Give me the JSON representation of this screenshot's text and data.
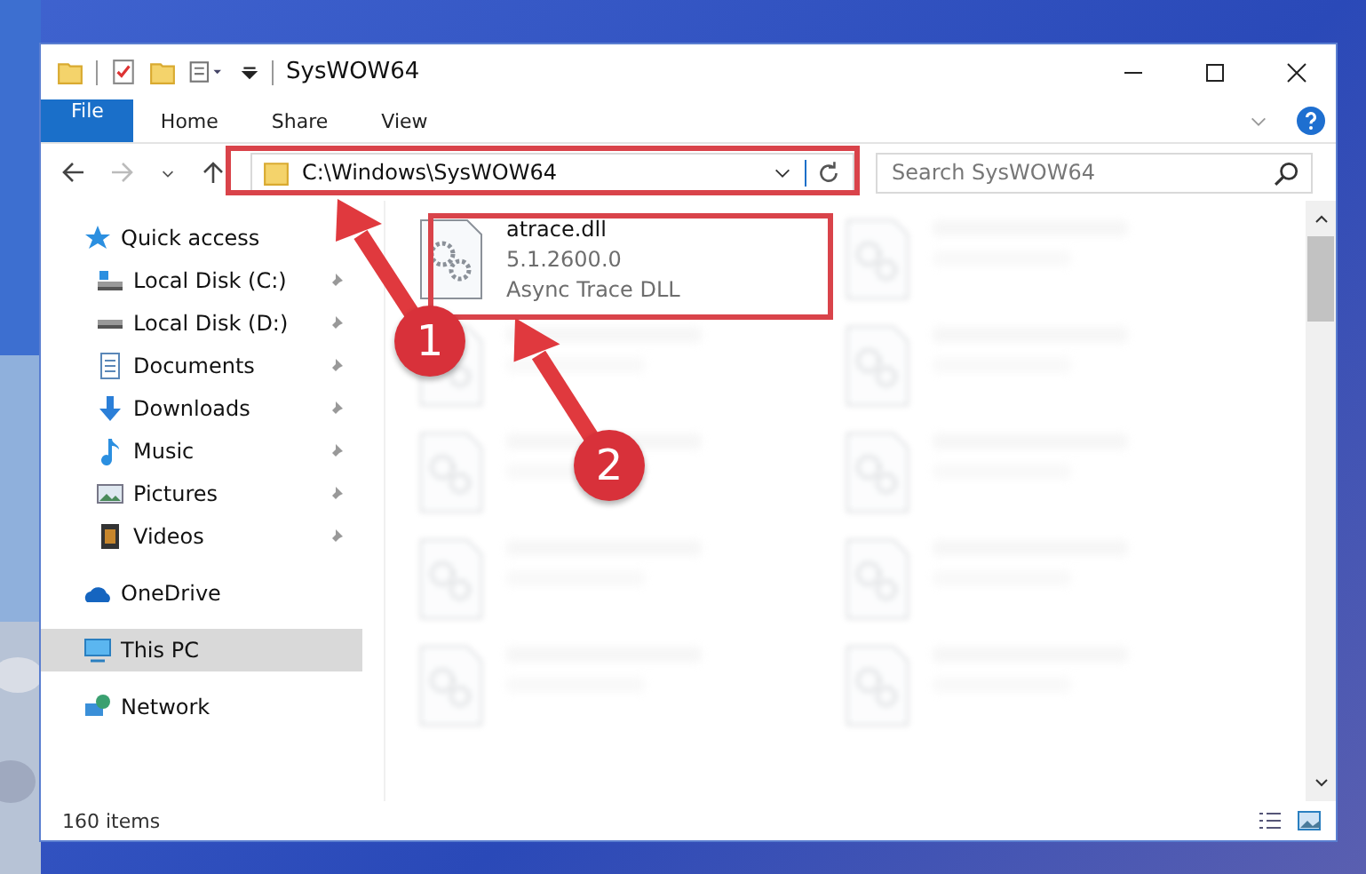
{
  "window": {
    "title": "SysWOW64"
  },
  "ribbon_tabs": [
    {
      "label": "File",
      "kind": "file"
    },
    {
      "label": "Home",
      "kind": "tab"
    },
    {
      "label": "Share",
      "kind": "tab"
    },
    {
      "label": "View",
      "kind": "tab"
    }
  ],
  "address_bar": {
    "path": "C:\\Windows\\SysWOW64"
  },
  "search": {
    "placeholder": "Search SysWOW64"
  },
  "sidebar": {
    "items": [
      {
        "label": "Quick access",
        "kind": "star",
        "selected": false,
        "children": [
          {
            "label": "Local Disk (C:)",
            "kind": "drive-win",
            "pinned": true
          },
          {
            "label": "Local Disk (D:)",
            "kind": "drive",
            "pinned": true
          },
          {
            "label": "Documents",
            "kind": "docs",
            "pinned": true
          },
          {
            "label": "Downloads",
            "kind": "download",
            "pinned": true
          },
          {
            "label": "Music",
            "kind": "music",
            "pinned": true
          },
          {
            "label": "Pictures",
            "kind": "pictures",
            "pinned": true
          },
          {
            "label": "Videos",
            "kind": "videos",
            "pinned": true
          }
        ]
      },
      {
        "label": "OneDrive",
        "kind": "cloud",
        "selected": false
      },
      {
        "label": "This PC",
        "kind": "pc",
        "selected": true
      },
      {
        "label": "Network",
        "kind": "network",
        "selected": false
      }
    ]
  },
  "files": [
    {
      "name": "atrace.dll",
      "details": [
        "5.1.2600.0",
        "Async Trace DLL"
      ],
      "blurred": false
    },
    {
      "blurred": true
    },
    {
      "blurred": true
    },
    {
      "blurred": true
    },
    {
      "blurred": true
    },
    {
      "blurred": true
    },
    {
      "blurred": true
    },
    {
      "blurred": true
    },
    {
      "blurred": true
    },
    {
      "blurred": true
    }
  ],
  "status_bar": {
    "item_count": "160 items"
  },
  "callouts": [
    {
      "number": "1"
    },
    {
      "number": "2"
    }
  ]
}
